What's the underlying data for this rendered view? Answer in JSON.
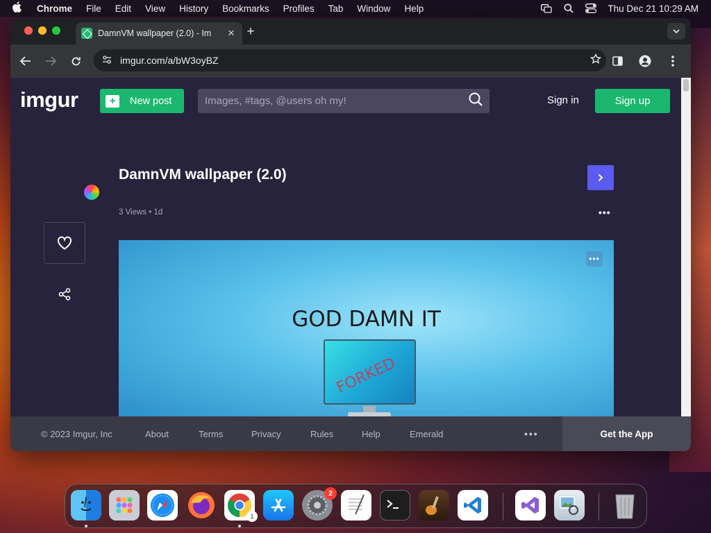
{
  "menubar": {
    "app": "Chrome",
    "items": [
      "File",
      "Edit",
      "View",
      "History",
      "Bookmarks",
      "Profiles",
      "Tab",
      "Window",
      "Help"
    ],
    "clock": "Thu Dec 21  10:29 AM"
  },
  "browser": {
    "tab_title": "DamnVM wallpaper (2.0) - Im",
    "tab_close": "✕",
    "new_tab": "+",
    "url": "imgur.com/a/bW3oyBZ"
  },
  "imgur": {
    "logo": "imgur",
    "new_post_label": "New post",
    "search_placeholder": "Images, #tags, @users oh my!",
    "sign_in": "Sign in",
    "sign_up": "Sign up",
    "post": {
      "title": "DamnVM wallpaper (2.0)",
      "meta": "3 Views • 1d",
      "image_caption": "GOD DAMN IT",
      "monitor_text": "FORKED"
    },
    "footer": {
      "copyright": "© 2023 Imgur, Inc",
      "links": [
        "About",
        "Terms",
        "Privacy",
        "Rules",
        "Help",
        "Emerald"
      ],
      "more": "•••",
      "get_app": "Get the App"
    }
  },
  "dock": {
    "apps": [
      "finder",
      "launchpad",
      "safari",
      "firefox",
      "chrome",
      "app-store",
      "system-settings",
      "textedit",
      "terminal",
      "garageband",
      "vscode",
      "visual-studio",
      "preview",
      "trash"
    ],
    "badges": {
      "system_settings": "2",
      "chrome": "1"
    }
  },
  "colors": {
    "imgur_bg": "#27233c",
    "imgur_green": "#1bb76e",
    "next_button": "#5b5bf0"
  }
}
